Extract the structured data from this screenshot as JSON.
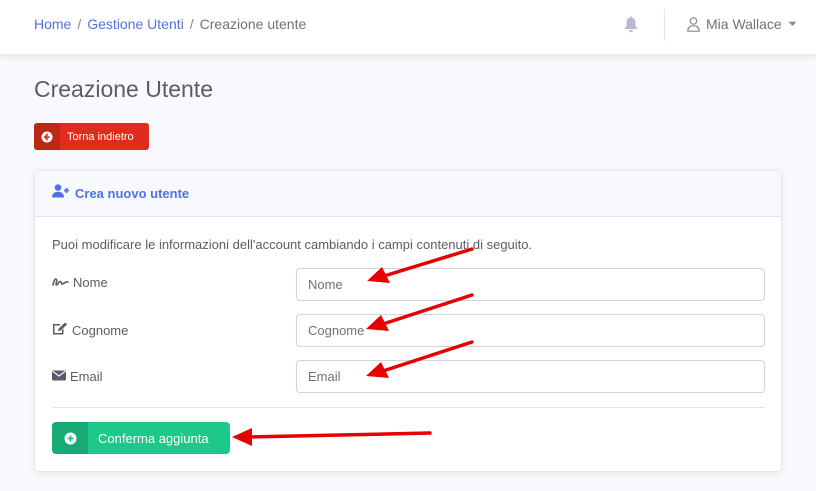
{
  "breadcrumb": {
    "home": "Home",
    "sep1": "/",
    "users": "Gestione Utenti",
    "sep2": "/",
    "current": "Creazione utente"
  },
  "topbar": {
    "bell_icon": "bell-icon",
    "user_name": "Mia Wallace"
  },
  "page": {
    "title": "Creazione Utente",
    "back_button": "Torna indietro"
  },
  "card": {
    "header_icon": "user-plus-icon",
    "header_title": "Crea nuovo utente",
    "help_text": "Puoi modificare le informazioni dell'account cambiando i campi contenuti di seguito.",
    "fields": [
      {
        "label": "Nome",
        "icon": "signature-icon",
        "placeholder": "Nome",
        "value": ""
      },
      {
        "label": "Cognome",
        "icon": "edit-icon",
        "placeholder": "Cognome",
        "value": ""
      },
      {
        "label": "Email",
        "icon": "envelope-icon",
        "placeholder": "Email",
        "value": ""
      }
    ],
    "confirm_button": "Conferma aggiunta"
  },
  "colors": {
    "primary": "#4e73df",
    "danger": "#e02d1b",
    "success": "#1cc88a",
    "annotation": "#e60000"
  }
}
